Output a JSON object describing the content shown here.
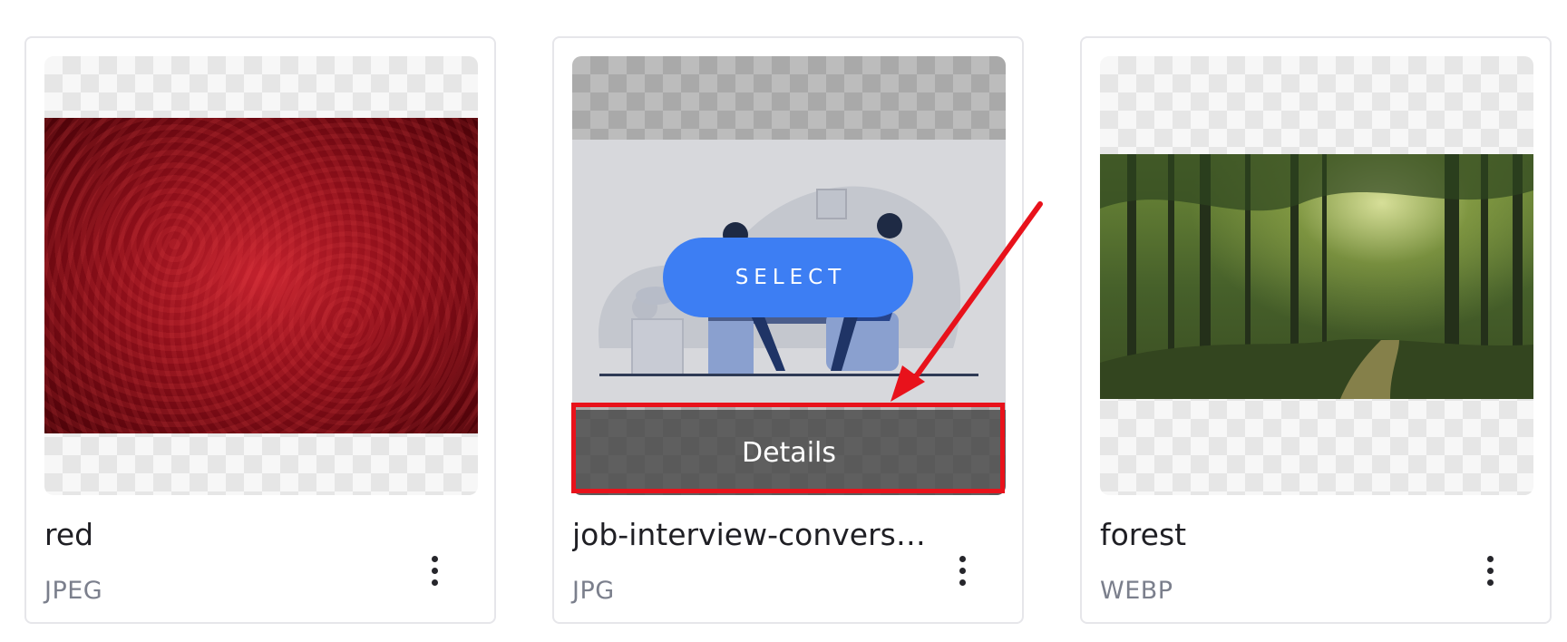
{
  "cards": [
    {
      "name": "red",
      "type": "JPEG"
    },
    {
      "name": "job-interview-convers…",
      "type": "JPG",
      "select_label": "SELECT",
      "details_label": "Details"
    },
    {
      "name": "forest",
      "type": "WEBP"
    }
  ],
  "colors": {
    "select_button": "#3d7ef3",
    "highlight": "#e8121b",
    "details_overlay": "#3c3c3c"
  },
  "icons": {
    "more_menu": "kebab-vertical-icon",
    "annotation": "red-arrow-icon"
  }
}
